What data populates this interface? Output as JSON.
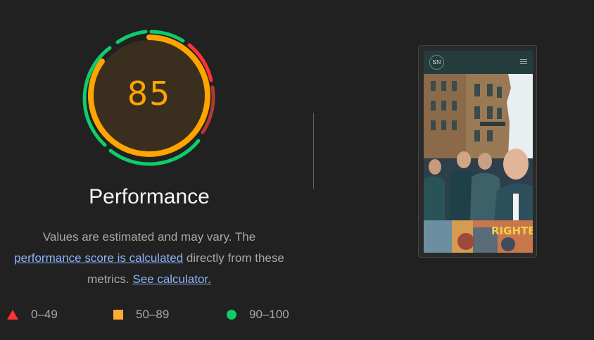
{
  "gauge": {
    "score": "85",
    "score_fraction": 0.85,
    "color": "#ffa400"
  },
  "title": "Performance",
  "description": {
    "text_1": "Values are estimated and may vary. The",
    "link_1": "performance score is calculated",
    "text_2": "directly from these",
    "text_3": "metrics.",
    "link_2": "See calculator."
  },
  "legend": [
    {
      "icon": "triangle-icon",
      "label": "0–49",
      "color": "#ff3333"
    },
    {
      "icon": "square-icon",
      "label": "50–89",
      "color": "#ffaa33"
    },
    {
      "icon": "circle-icon",
      "label": "90–100",
      "color": "#0cce6b"
    }
  ],
  "screenshot": {
    "logo_text": "SN",
    "menu_icon": "hamburger-menu-icon",
    "mural_text": "RIGHTE"
  }
}
